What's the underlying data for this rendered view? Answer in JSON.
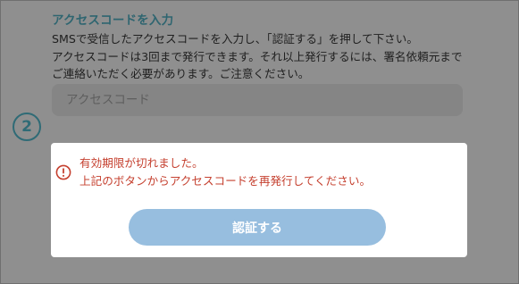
{
  "section": {
    "title": "アクセスコードを入力",
    "lines": [
      "SMSで受信したアクセスコードを入力し、「認証する」を押して下さい。",
      "アクセスコードは3回まで発行できます。それ以上発行するには、署名依頼元まで",
      "ご連絡いただく必要があります。ご注意ください。"
    ]
  },
  "input": {
    "placeholder": "アクセスコード",
    "value": ""
  },
  "step": {
    "number": "2"
  },
  "modal": {
    "error_lines": [
      "有効期限が切れました。",
      "上記のボタンからアクセスコードを再発行してください。"
    ],
    "button_label": "認証する"
  },
  "colors": {
    "accent": "#2f6b76",
    "error": "#c5402f",
    "button": "#97bedf"
  },
  "icons": {
    "error": "error-circle-icon"
  }
}
